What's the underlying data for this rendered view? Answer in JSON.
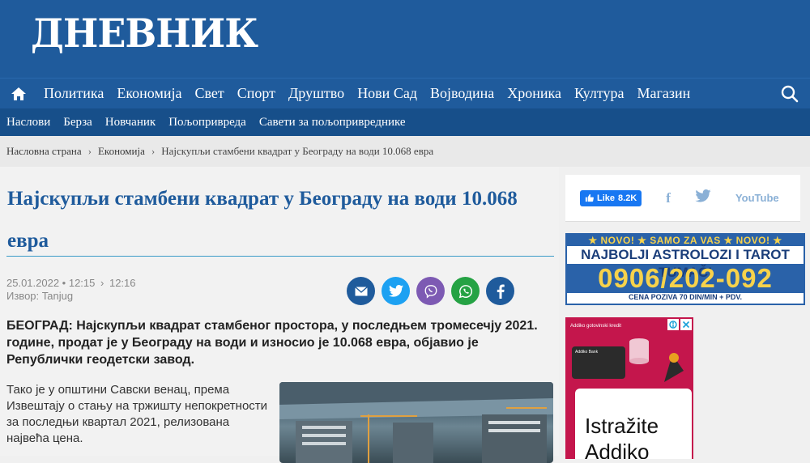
{
  "header": {
    "logo": "ДНЕВНИК"
  },
  "nav": {
    "items": [
      "Политика",
      "Економија",
      "Свет",
      "Спорт",
      "Друштво",
      "Нови Сад",
      "Војводина",
      "Хроника",
      "Култура",
      "Магазин"
    ]
  },
  "subnav": {
    "items": [
      "Наслови",
      "Берза",
      "Новчаник",
      "Пољопривреда",
      "Савети за пољопривреднике"
    ]
  },
  "breadcrumb": {
    "home": "Насловна страна",
    "section": "Економија",
    "current": "Најскупљи стамбени квадрат у Београду на води 10.068 евра"
  },
  "article": {
    "title": "Најскупљи стамбени квадрат у Београду на води 10.068 евра",
    "date": "25.01.2022 • 12:15",
    "updated": "12:16",
    "source": "Извор: Tanjug",
    "lead": "БЕОГРАД: Најскупљи квадрат стамбеног простора, у последњем тромесечју 2021. године, продат је у Београду на води и износио је 10.068 евра, објавио је Републички геодетски завод.",
    "body": "Тако је у општини Савски венац, према Извештају о стању на тржишту непокретности за последњи квартал 2021, релизована највећа цена."
  },
  "sidebar": {
    "fb_like": "Like",
    "fb_count": "8.2K",
    "youtube": "YouTube",
    "ad1": {
      "top": "★ NOVO! ★ SAMO ZA VAS ★ NOVO! ★",
      "mid": "NAJBOLJI ASTROLOZI I TAROT TUMAČI",
      "phone": "0906/202-092",
      "bottom": "CENA POZIVA 70 DIN/MIN + PDV."
    },
    "ad2": {
      "small": "Addiko gotovinski kredit",
      "bank": "Addiko Bank",
      "text_line1": "Istražite",
      "text_line2": "Addiko"
    }
  },
  "colors": {
    "brand": "#1f5b9c",
    "subnav": "#174f8a",
    "accent_line": "#3a9bc8"
  }
}
